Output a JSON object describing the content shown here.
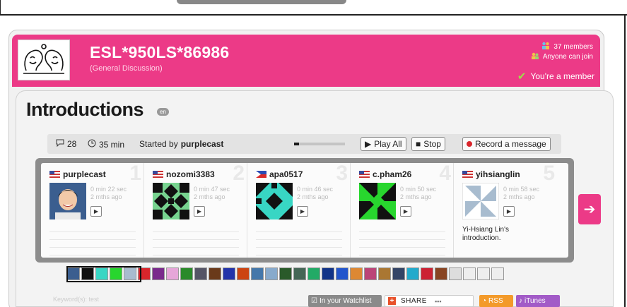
{
  "group": {
    "title": "ESL*950LS*86986",
    "subtitle": "(General Discussion)",
    "members": "37 members",
    "join": "Anyone can join",
    "membership": "You're a member"
  },
  "page": {
    "heading": "Introductions",
    "lang_badge": "en"
  },
  "thread": {
    "message_count": "28",
    "total_time": "35 min",
    "started_by_label": "Started by",
    "started_by_user": "purplecast",
    "progress": 0.1,
    "play_all": "Play All",
    "stop": "Stop",
    "record": "Record a message"
  },
  "cards": [
    {
      "num": "1",
      "user": "purplecast",
      "flag": "us",
      "duration": "0 min 22 sec",
      "age": "2 mths ago",
      "caption": ""
    },
    {
      "num": "2",
      "user": "nozomi3383",
      "flag": "us",
      "duration": "0 min 47 sec",
      "age": "2 mths ago",
      "caption": ""
    },
    {
      "num": "3",
      "user": "apa0517",
      "flag": "ph",
      "duration": "0 min 46 sec",
      "age": "2 mths ago",
      "caption": ""
    },
    {
      "num": "4",
      "user": "c.pham26",
      "flag": "us",
      "duration": "0 min 50 sec",
      "age": "2 mths ago",
      "caption": ""
    },
    {
      "num": "5",
      "user": "yihsianglin",
      "flag": "us",
      "duration": "0 min 58 sec",
      "age": "2 mths ago",
      "caption": "Yi-Hsiang Lin's introduction."
    }
  ],
  "footer": {
    "keywords": "Keyword(s): test",
    "watchlist": "In your Watchlist",
    "share": "SHARE",
    "rss": "RSS",
    "itunes": "iTunes"
  },
  "colors": {
    "brand_pink": "#ec3a87",
    "record_red": "#d9252b"
  }
}
